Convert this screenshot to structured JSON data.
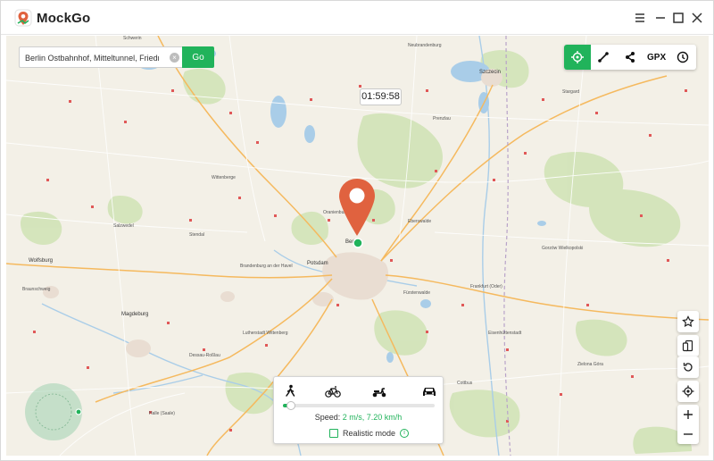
{
  "app": {
    "title": "MockGo"
  },
  "search": {
    "value": "Berlin Ostbahnhof, Mitteltunnel, Friedrich",
    "go_label": "Go"
  },
  "toolbar": {
    "gpx_label": "GPX"
  },
  "timer": {
    "value": "01:59:58"
  },
  "speed_panel": {
    "speed_label": "Speed:",
    "speed_value": "2 m/s, 7.20 km/h",
    "realistic_label": "Realistic mode",
    "slider_fraction": 0.05
  },
  "colors": {
    "accent": "#21b35b",
    "pin": "#e0623f"
  },
  "map_labels": [
    "Schwerin",
    "Szczecin",
    "Berlin",
    "Potsdam",
    "Wolfsburg",
    "Magdeburg",
    "Braunschweig",
    "Stargard",
    "Brandenburg an der Havel",
    "Frankfurt (Oder)",
    "Halle (Saale)",
    "Cottbus",
    "Neubrandenburg",
    "Prenzlau",
    "Wittenberge",
    "Salzwedel",
    "Stendal",
    "Gorzów Wielkopolski",
    "Eberswalde",
    "Oranienburg",
    "Fürstenwalde",
    "Dessau-Roßlau",
    "Lutherstadt Wittenberg",
    "Eisenhüttenstadt",
    "Zielona Góra"
  ]
}
